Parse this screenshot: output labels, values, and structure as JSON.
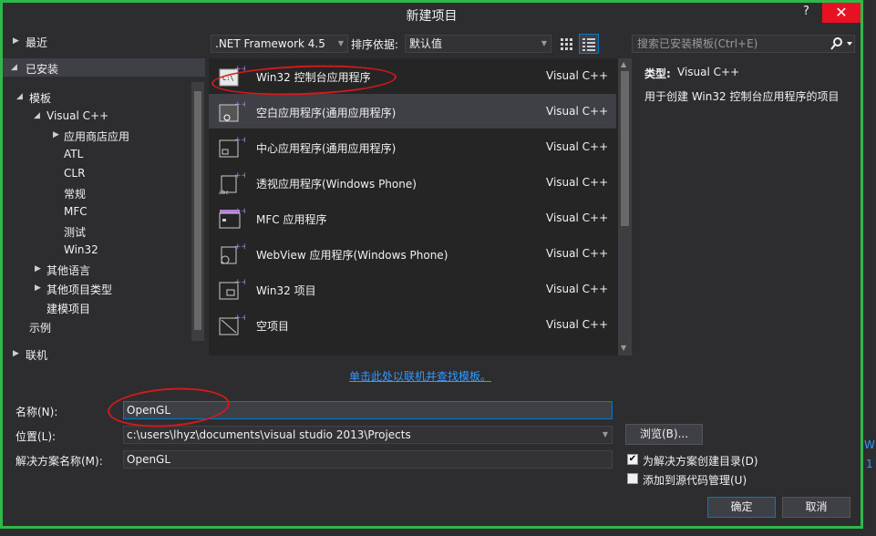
{
  "window": {
    "title": "新建项目",
    "help": "?",
    "close": "✕"
  },
  "tree": {
    "recent": "最近",
    "installed": "已安装",
    "templates": "模板",
    "visual_cpp": "Visual C++",
    "store_apps": "应用商店应用",
    "atl": "ATL",
    "clr": "CLR",
    "general": "常规",
    "mfc": "MFC",
    "test": "测试",
    "win32": "Win32",
    "other_languages": "其他语言",
    "other_project_types": "其他项目类型",
    "modeling_projects": "建模项目",
    "samples": "示例",
    "online": "联机"
  },
  "toolbar": {
    "framework": ".NET Framework 4.5",
    "sort_label": "排序依据:",
    "sort_value": "默认值",
    "search_placeholder": "搜索已安装模板(Ctrl+E)"
  },
  "templates": [
    {
      "name": "Win32 控制台应用程序",
      "type": "Visual C++",
      "icon": "console-app-icon"
    },
    {
      "name": "空白应用程序(通用应用程序)",
      "type": "Visual C++",
      "icon": "blank-app-icon"
    },
    {
      "name": "中心应用程序(通用应用程序)",
      "type": "Visual C++",
      "icon": "hub-app-icon"
    },
    {
      "name": "透视应用程序(Windows Phone)",
      "type": "Visual C++",
      "icon": "pivot-app-icon"
    },
    {
      "name": "MFC 应用程序",
      "type": "Visual C++",
      "icon": "mfc-app-icon"
    },
    {
      "name": "WebView 应用程序(Windows Phone)",
      "type": "Visual C++",
      "icon": "webview-app-icon"
    },
    {
      "name": "Win32 项目",
      "type": "Visual C++",
      "icon": "win32-project-icon"
    },
    {
      "name": "空项目",
      "type": "Visual C++",
      "icon": "empty-project-icon"
    }
  ],
  "info": {
    "type_label": "类型:",
    "type_value": "Visual C++",
    "description": "用于创建 Win32 控制台应用程序的项目"
  },
  "online_link": "单击此处以联机并查找模板。",
  "form": {
    "name_label": "名称(N):",
    "name_value": "OpenGL",
    "location_label": "位置(L):",
    "location_value": "c:\\users\\lhyz\\documents\\visual studio 2013\\Projects",
    "solution_label": "解决方案名称(M):",
    "solution_value": "OpenGL",
    "browse": "浏览(B)...",
    "create_dir": "为解决方案创建目录(D)",
    "create_dir_checked": true,
    "add_source_control": "添加到源代码管理(U)",
    "add_source_control_checked": false,
    "ok": "确定",
    "cancel": "取消"
  },
  "colors": {
    "accent_frame": "#2fb84a",
    "close": "#e81123",
    "link": "#3399ff",
    "annotation": "#d11a1a"
  }
}
